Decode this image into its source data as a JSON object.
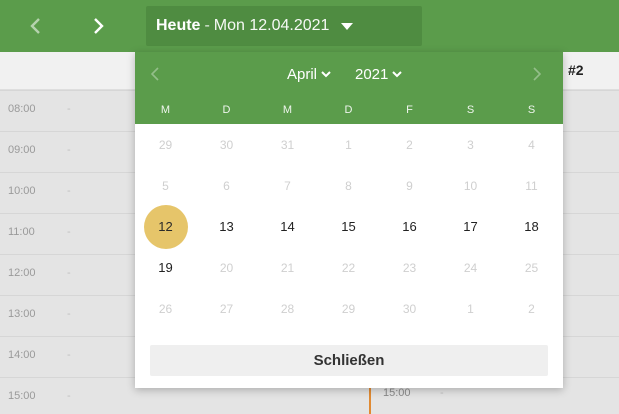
{
  "topbar": {
    "prev_icon": "chevron-left-icon",
    "next_icon": "chevron-right-icon",
    "today_label": "Heute",
    "separator": "-",
    "date_text": "Mon 12.04.2021",
    "caret_icon": "caret-down-icon",
    "color": "#5b9c4b"
  },
  "calendar": {
    "column_label": "#2",
    "times": [
      "08:00",
      "09:00",
      "10:00",
      "11:00",
      "12:00",
      "13:00",
      "14:00",
      "15:00"
    ],
    "dash": "-",
    "event": {
      "time": "15:00",
      "dash": "-",
      "color": "#e08a33"
    }
  },
  "popup": {
    "prev_month_label": "",
    "prev_month_icon": "chevron-left-icon",
    "next_month_icon": "chevron-right-icon",
    "month": "April",
    "year": "2021",
    "dropdown_icon": "chevron-down-icon",
    "weekdays": [
      "M",
      "D",
      "M",
      "D",
      "F",
      "S",
      "S"
    ],
    "weeks": [
      [
        {
          "d": "29",
          "dim": true
        },
        {
          "d": "30",
          "dim": true
        },
        {
          "d": "31",
          "dim": true
        },
        {
          "d": "1",
          "dim": true
        },
        {
          "d": "2",
          "dim": true
        },
        {
          "d": "3",
          "dim": true
        },
        {
          "d": "4",
          "dim": true
        }
      ],
      [
        {
          "d": "5",
          "dim": true
        },
        {
          "d": "6",
          "dim": true
        },
        {
          "d": "7",
          "dim": true
        },
        {
          "d": "8",
          "dim": true
        },
        {
          "d": "9",
          "dim": true
        },
        {
          "d": "10",
          "dim": true
        },
        {
          "d": "11",
          "dim": true
        }
      ],
      [
        {
          "d": "12",
          "dim": false,
          "selected": true
        },
        {
          "d": "13",
          "dim": false
        },
        {
          "d": "14",
          "dim": false
        },
        {
          "d": "15",
          "dim": false
        },
        {
          "d": "16",
          "dim": false
        },
        {
          "d": "17",
          "dim": false
        },
        {
          "d": "18",
          "dim": false
        }
      ],
      [
        {
          "d": "19",
          "dim": false
        },
        {
          "d": "20",
          "dim": true
        },
        {
          "d": "21",
          "dim": true
        },
        {
          "d": "22",
          "dim": true
        },
        {
          "d": "23",
          "dim": true
        },
        {
          "d": "24",
          "dim": true
        },
        {
          "d": "25",
          "dim": true
        }
      ],
      [
        {
          "d": "26",
          "dim": true
        },
        {
          "d": "27",
          "dim": true
        },
        {
          "d": "28",
          "dim": true
        },
        {
          "d": "29",
          "dim": true
        },
        {
          "d": "30",
          "dim": true
        },
        {
          "d": "1",
          "dim": true
        },
        {
          "d": "2",
          "dim": true
        }
      ]
    ],
    "selected_color": "#e6c56a",
    "close_label": "Schließen"
  }
}
